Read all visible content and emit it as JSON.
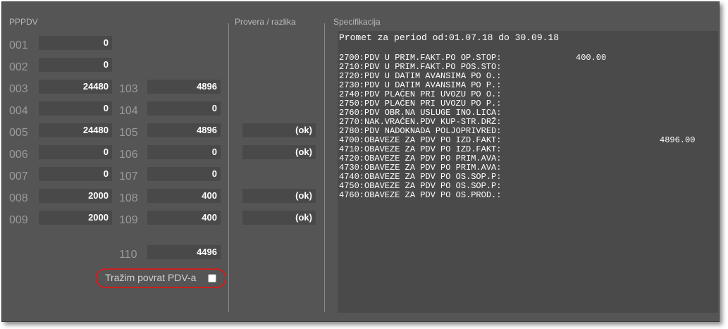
{
  "sections": {
    "pppdv": "PPPDV",
    "provera": "Provera / razlika",
    "specifikacija": "Specifikacija"
  },
  "left_rows": [
    {
      "code": "001",
      "value": "0"
    },
    {
      "code": "002",
      "value": "0"
    },
    {
      "code": "003",
      "value": "24480"
    },
    {
      "code": "004",
      "value": "0"
    },
    {
      "code": "005",
      "value": "24480"
    },
    {
      "code": "006",
      "value": "0"
    },
    {
      "code": "007",
      "value": "0"
    },
    {
      "code": "008",
      "value": "2000"
    },
    {
      "code": "009",
      "value": "2000"
    }
  ],
  "right_rows": [
    {
      "code": "103",
      "value": "4896"
    },
    {
      "code": "104",
      "value": "0"
    },
    {
      "code": "105",
      "value": "4896"
    },
    {
      "code": "106",
      "value": "0"
    },
    {
      "code": "107",
      "value": "0"
    },
    {
      "code": "108",
      "value": "400"
    },
    {
      "code": "109",
      "value": "400"
    },
    {
      "code": "110",
      "value": "4496"
    }
  ],
  "provera": [
    "(ok)",
    "(ok)",
    "(ok)",
    "(ok)"
  ],
  "checkbox": {
    "label": "Tražim povrat PDV-a",
    "checked": false
  },
  "spec": {
    "header": "Promet za period od:01.07.18 do 30.09.18",
    "lines": [
      {
        "label": "2700:PDV U PRIM.FAKT.PO OP.STOP:",
        "v1": "400.00",
        "v2": ""
      },
      {
        "label": "2710:PDV U PRIM.FAKT.PO POS.STO:",
        "v1": "",
        "v2": ""
      },
      {
        "label": "2720:PDV U DATIM AVANSIMA PO O.:",
        "v1": "",
        "v2": ""
      },
      {
        "label": "2730:PDV U DATIM AVANSIMA PO P.:",
        "v1": "",
        "v2": ""
      },
      {
        "label": "2740:PDV PLAĆEN PRI UVOZU PO O.:",
        "v1": "",
        "v2": ""
      },
      {
        "label": "2750:PDV PLAĆEN PRI UVOZU PO P.:",
        "v1": "",
        "v2": ""
      },
      {
        "label": "2760:PDV OBR.NA USLUGE INO.LICA:",
        "v1": "",
        "v2": ""
      },
      {
        "label": "2770:NAK.VRAĆEN.PDV KUP-STR.DRŽ:",
        "v1": "",
        "v2": ""
      },
      {
        "label": "2780:PDV NADOKNADA POLJOPRIVRED:",
        "v1": "",
        "v2": ""
      },
      {
        "label": "4700:OBAVEZE ZA PDV PO IZD.FAKT:",
        "v1": "",
        "v2": "4896.00"
      },
      {
        "label": "4710:OBAVEZE ZA PDV PO IZD.FAKT:",
        "v1": "",
        "v2": ""
      },
      {
        "label": "4720:OBAVEZE ZA PDV PO PRIM.AVA:",
        "v1": "",
        "v2": ""
      },
      {
        "label": "4730:OBAVEZE ZA PDV PO PRIM.AVA:",
        "v1": "",
        "v2": ""
      },
      {
        "label": "4740:OBAVEZE ZA PDV PO OS.SOP.P:",
        "v1": "",
        "v2": ""
      },
      {
        "label": "4750:OBAVEZE ZA PDV PO OS.SOP.P:",
        "v1": "",
        "v2": ""
      },
      {
        "label": "4760:OBAVEZE ZA PDV PO OS.PROD.:",
        "v1": "",
        "v2": ""
      }
    ]
  }
}
